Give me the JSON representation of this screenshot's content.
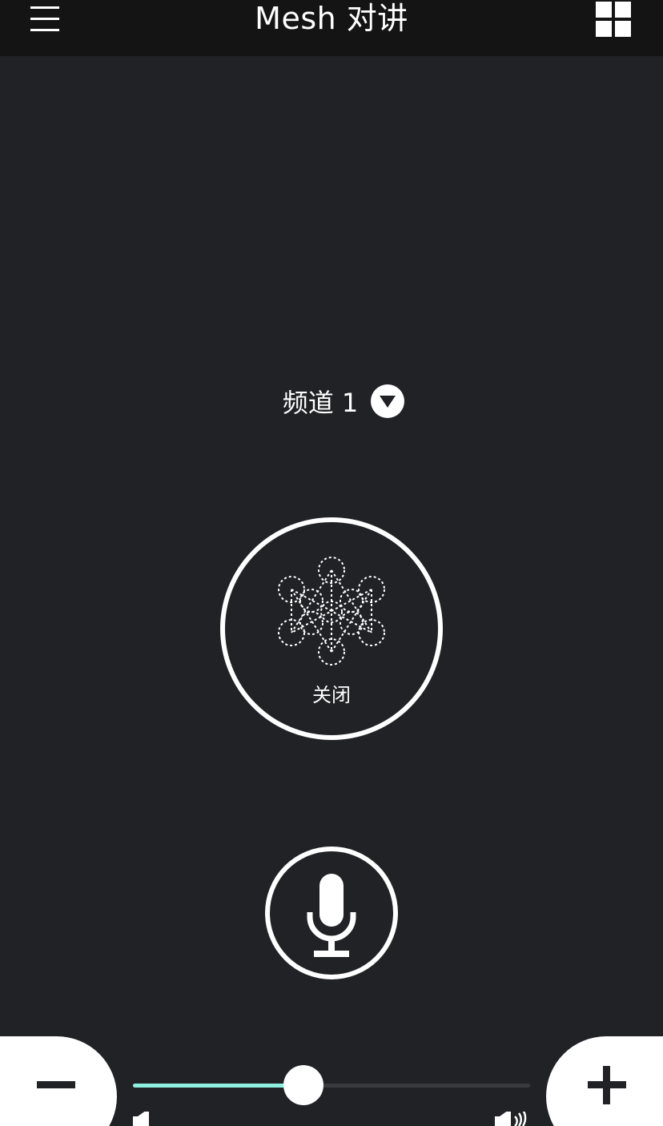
{
  "header": {
    "title": "Mesh 对讲",
    "menu_icon": "hamburger-menu-icon",
    "grid_icon": "grid-view-icon"
  },
  "channel": {
    "label": "频道 1",
    "dropdown_icon": "chevron-down-circle-icon"
  },
  "mesh": {
    "status_label": "关闭",
    "icon": "mesh-network-icon"
  },
  "mic": {
    "icon": "microphone-icon"
  },
  "volume": {
    "level": 0.43,
    "minus_icon": "minus-icon",
    "plus_icon": "plus-icon",
    "low_icon": "speaker-low-icon",
    "high_icon": "speaker-high-icon",
    "fill_color": "#8ff0e0"
  },
  "colors": {
    "background": "#212226",
    "topbar": "#141414",
    "foreground": "#ffffff"
  }
}
